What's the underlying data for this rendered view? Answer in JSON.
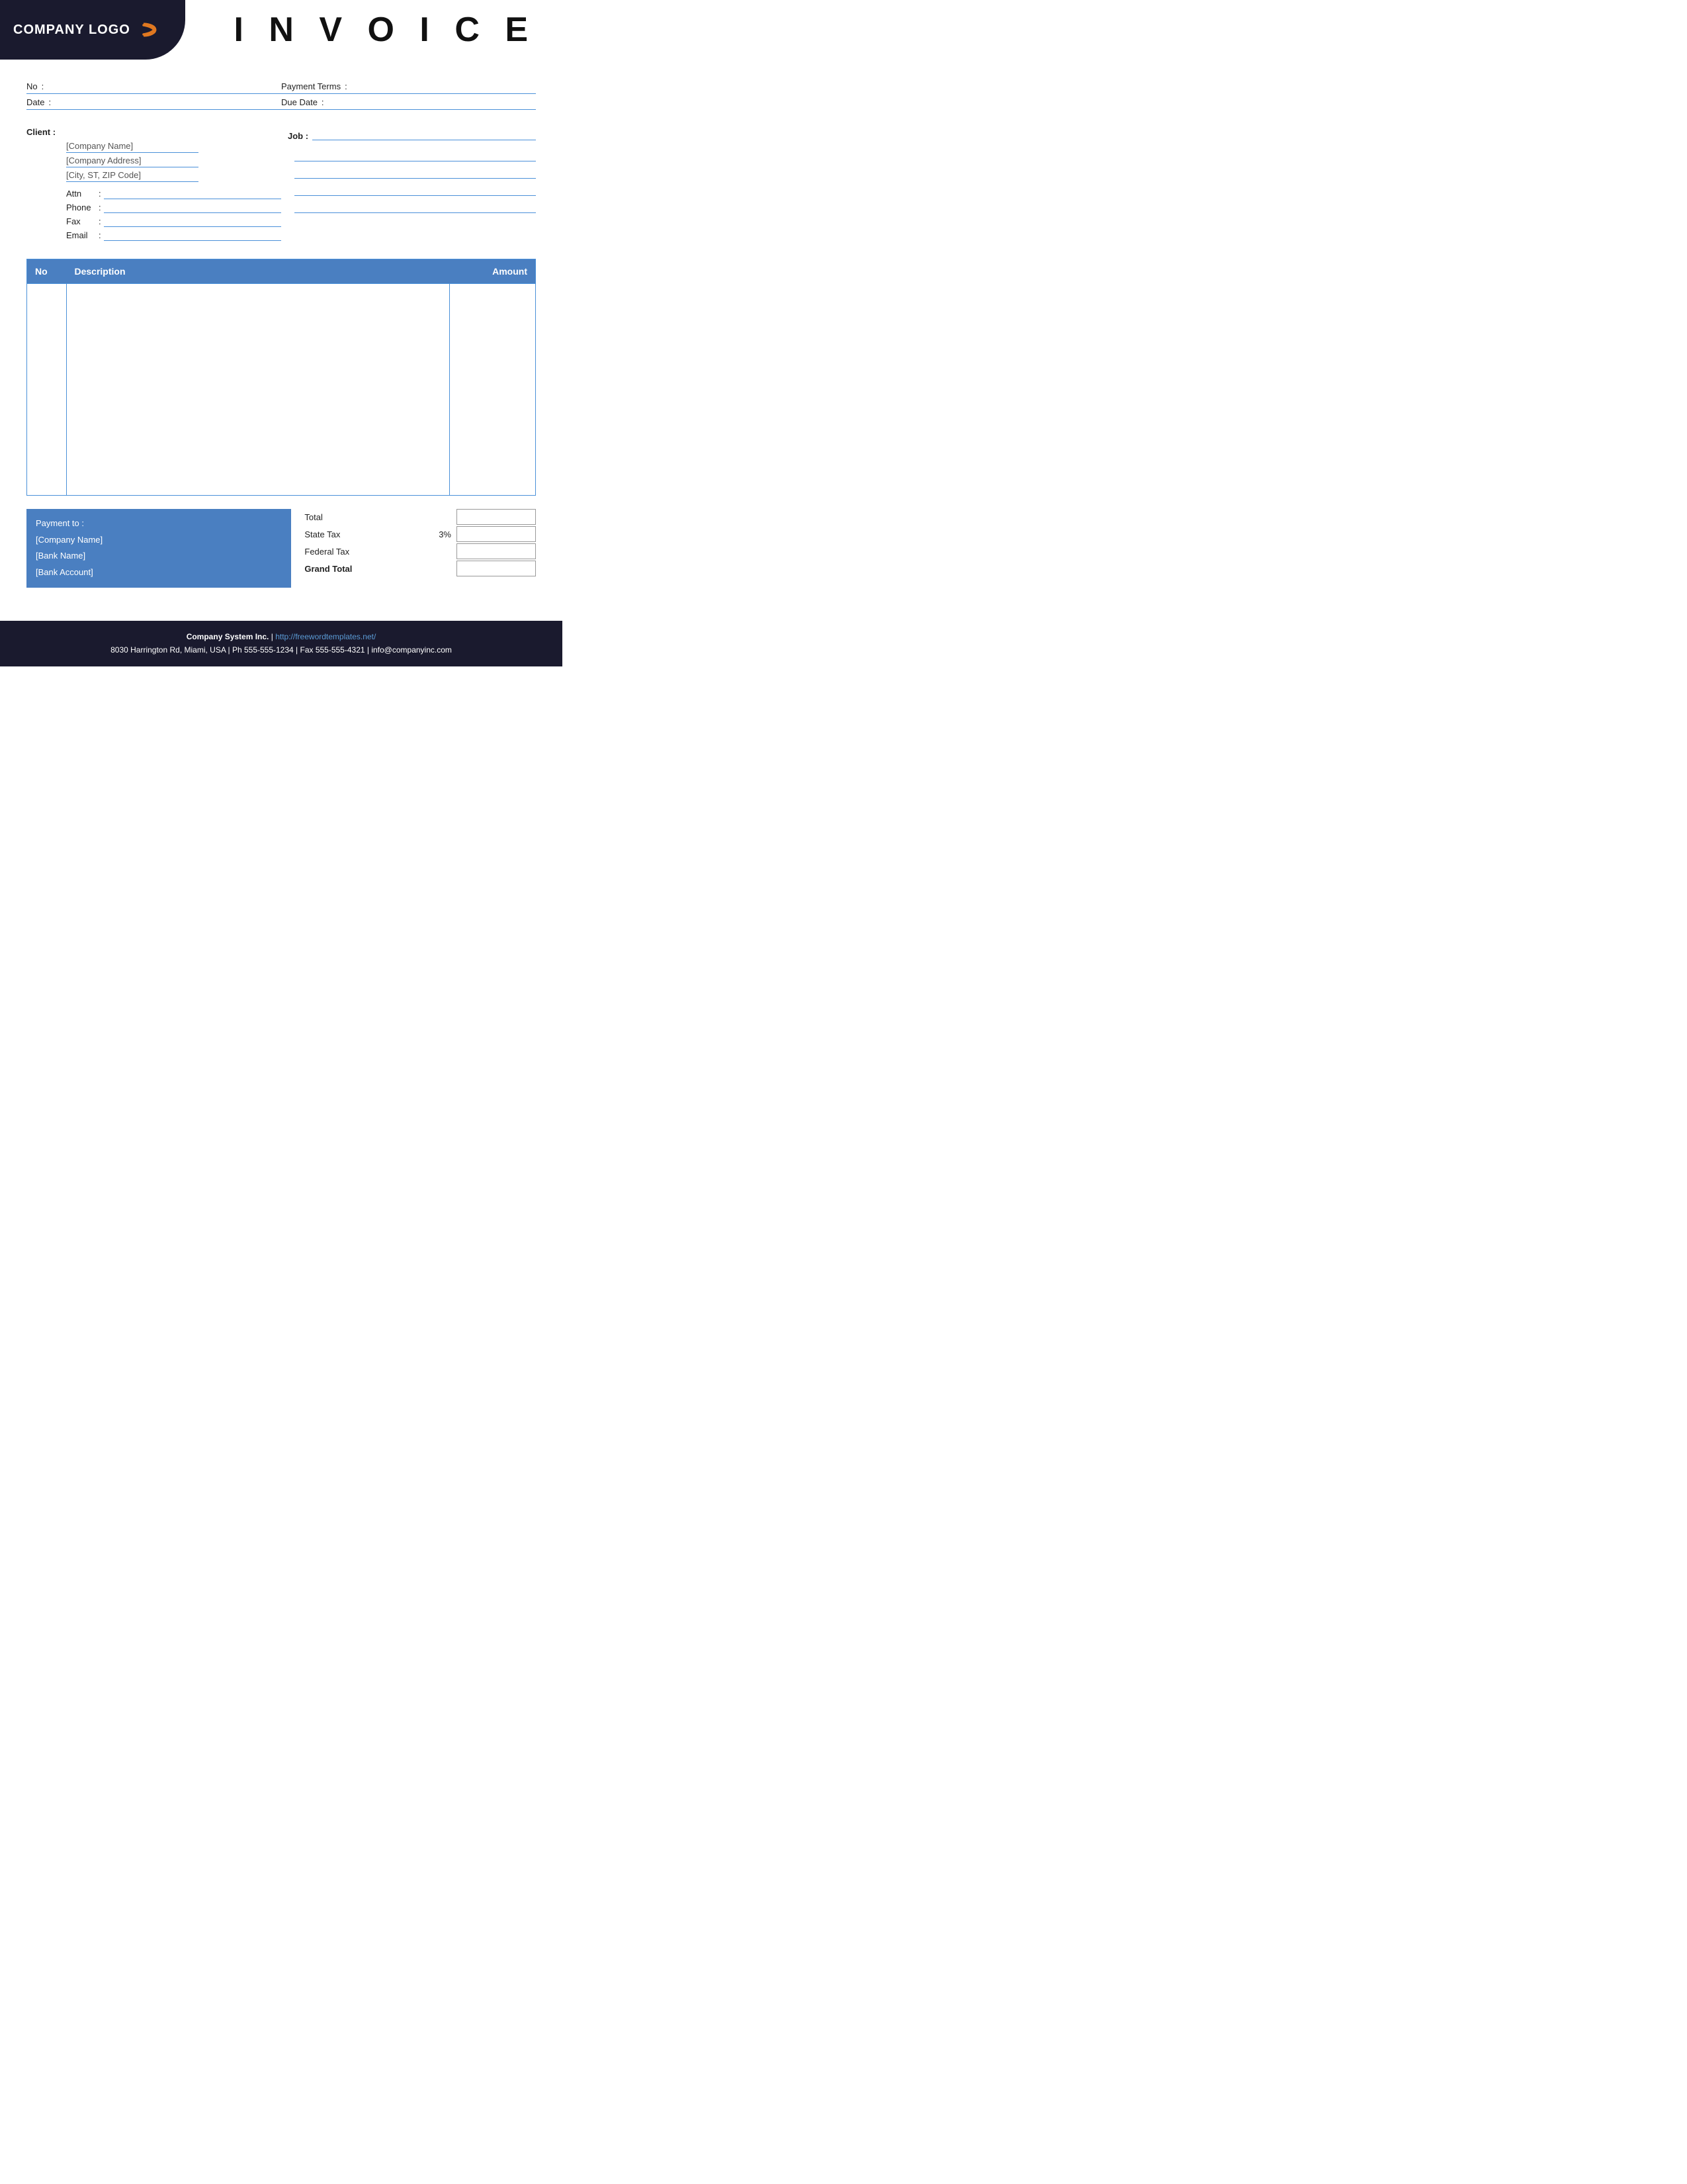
{
  "header": {
    "logo_text": "COMPANY LOGO",
    "invoice_title": "I N V O I C E"
  },
  "meta": {
    "no_label": "No",
    "no_colon": ":",
    "payment_terms_label": "Payment  Terms",
    "payment_terms_colon": ":",
    "date_label": "Date",
    "date_colon": ":",
    "due_date_label": "Due Date",
    "due_date_colon": ":"
  },
  "client": {
    "label": "Client  :",
    "name": "[Company Name]",
    "address": "[Company Address]",
    "city": "[City, ST, ZIP Code]",
    "attn_label": "Attn",
    "attn_colon": ":",
    "phone_label": "Phone",
    "phone_colon": ":",
    "fax_label": "Fax",
    "fax_colon": ":",
    "email_label": "Email",
    "email_colon": ":"
  },
  "job": {
    "label": "Job  :"
  },
  "table": {
    "col_no": "No",
    "col_description": "Description",
    "col_amount": "Amount"
  },
  "payment": {
    "title": "Payment to :",
    "company": "[Company Name]",
    "bank": "[Bank Name]",
    "account": "[Bank Account]"
  },
  "totals": {
    "total_label": "Total",
    "state_tax_label": "State Tax",
    "state_tax_percent": "3%",
    "federal_tax_label": "Federal Tax",
    "grand_total_label": "Grand Total"
  },
  "footer": {
    "company": "Company System Inc.",
    "separator": " | ",
    "website": "http://freewordtemplates.net/",
    "address": "8030 Harrington Rd, Miami, USA | Ph 555-555-1234 | Fax 555-555-4321 | info@companyinc.com"
  }
}
